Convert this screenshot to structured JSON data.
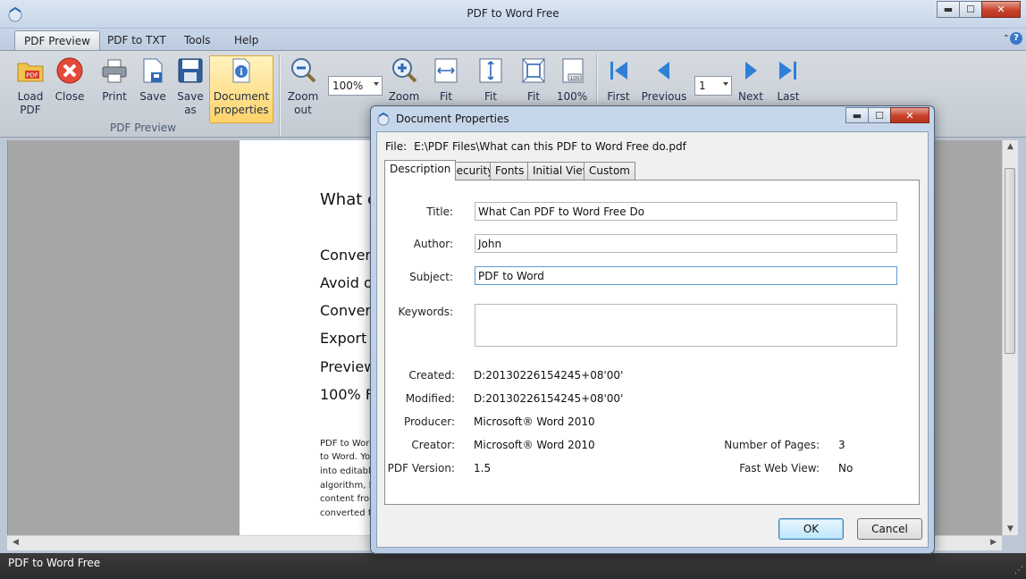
{
  "app": {
    "title": "PDF to Word Free"
  },
  "window_controls": {
    "minimize": "▬",
    "maximize": "☐",
    "close": "✕"
  },
  "ribbon_tabs": [
    "PDF Preview",
    "PDF to TXT",
    "Tools",
    "Help"
  ],
  "ribbon": {
    "load_pdf": "Load\nPDF",
    "close": "Close",
    "print": "Print",
    "save": "Save",
    "save_as": "Save\nas",
    "document_properties": "Document\nproperties",
    "group_pdf_preview": "PDF Preview",
    "zoom_out": "Zoom\nout",
    "zoom_value": "100%",
    "zoom_in": "Zoom",
    "fit_width": "Fit",
    "fit_height": "Fit",
    "fit_page": "Fit",
    "actual_size": "100%",
    "first": "First",
    "previous": "Previous",
    "page_value": "1",
    "next": "Next",
    "last": "Last"
  },
  "preview_page": {
    "heading": "What c",
    "lines": [
      "Convert",
      "Avoid o",
      "Convert",
      "Export o",
      "Preview",
      "100% F"
    ],
    "paragraph": [
      "PDF to Word",
      "to Word. Yo",
      "into editable",
      "algorithm, P",
      "content from",
      "converted fil"
    ]
  },
  "status": {
    "text": "PDF to Word Free"
  },
  "dialog": {
    "title": "Document Properties",
    "file_label": "File:",
    "file_path": "E:\\PDF Files\\What can this PDF to Word Free do.pdf",
    "tabs": [
      "Description",
      "Security",
      "Fonts",
      "Initial View",
      "Custom"
    ],
    "fields": {
      "title_label": "Title:",
      "title_value": "What Can PDF to Word Free Do",
      "author_label": "Author:",
      "author_value": "John",
      "subject_label": "Subject:",
      "subject_value": "PDF to Word",
      "keywords_label": "Keywords:",
      "keywords_value": ""
    },
    "info": {
      "created_label": "Created:",
      "created_value": "D:20130226154245+08'00'",
      "modified_label": "Modified:",
      "modified_value": "D:20130226154245+08'00'",
      "producer_label": "Producer:",
      "producer_value": "Microsoft® Word 2010",
      "creator_label": "Creator:",
      "creator_value": "Microsoft® Word 2010",
      "pdf_version_label": "PDF Version:",
      "pdf_version_value": "1.5",
      "num_pages_label": "Number of Pages:",
      "num_pages_value": "3",
      "fast_web_label": "Fast Web View:",
      "fast_web_value": "No"
    },
    "ok": "OK",
    "cancel": "Cancel"
  },
  "colors": {
    "accent": "#3b78c8",
    "selected_ribbon": "#ffd36a",
    "close_red": "#c7422b",
    "status_bar": "#2c2c2c"
  }
}
